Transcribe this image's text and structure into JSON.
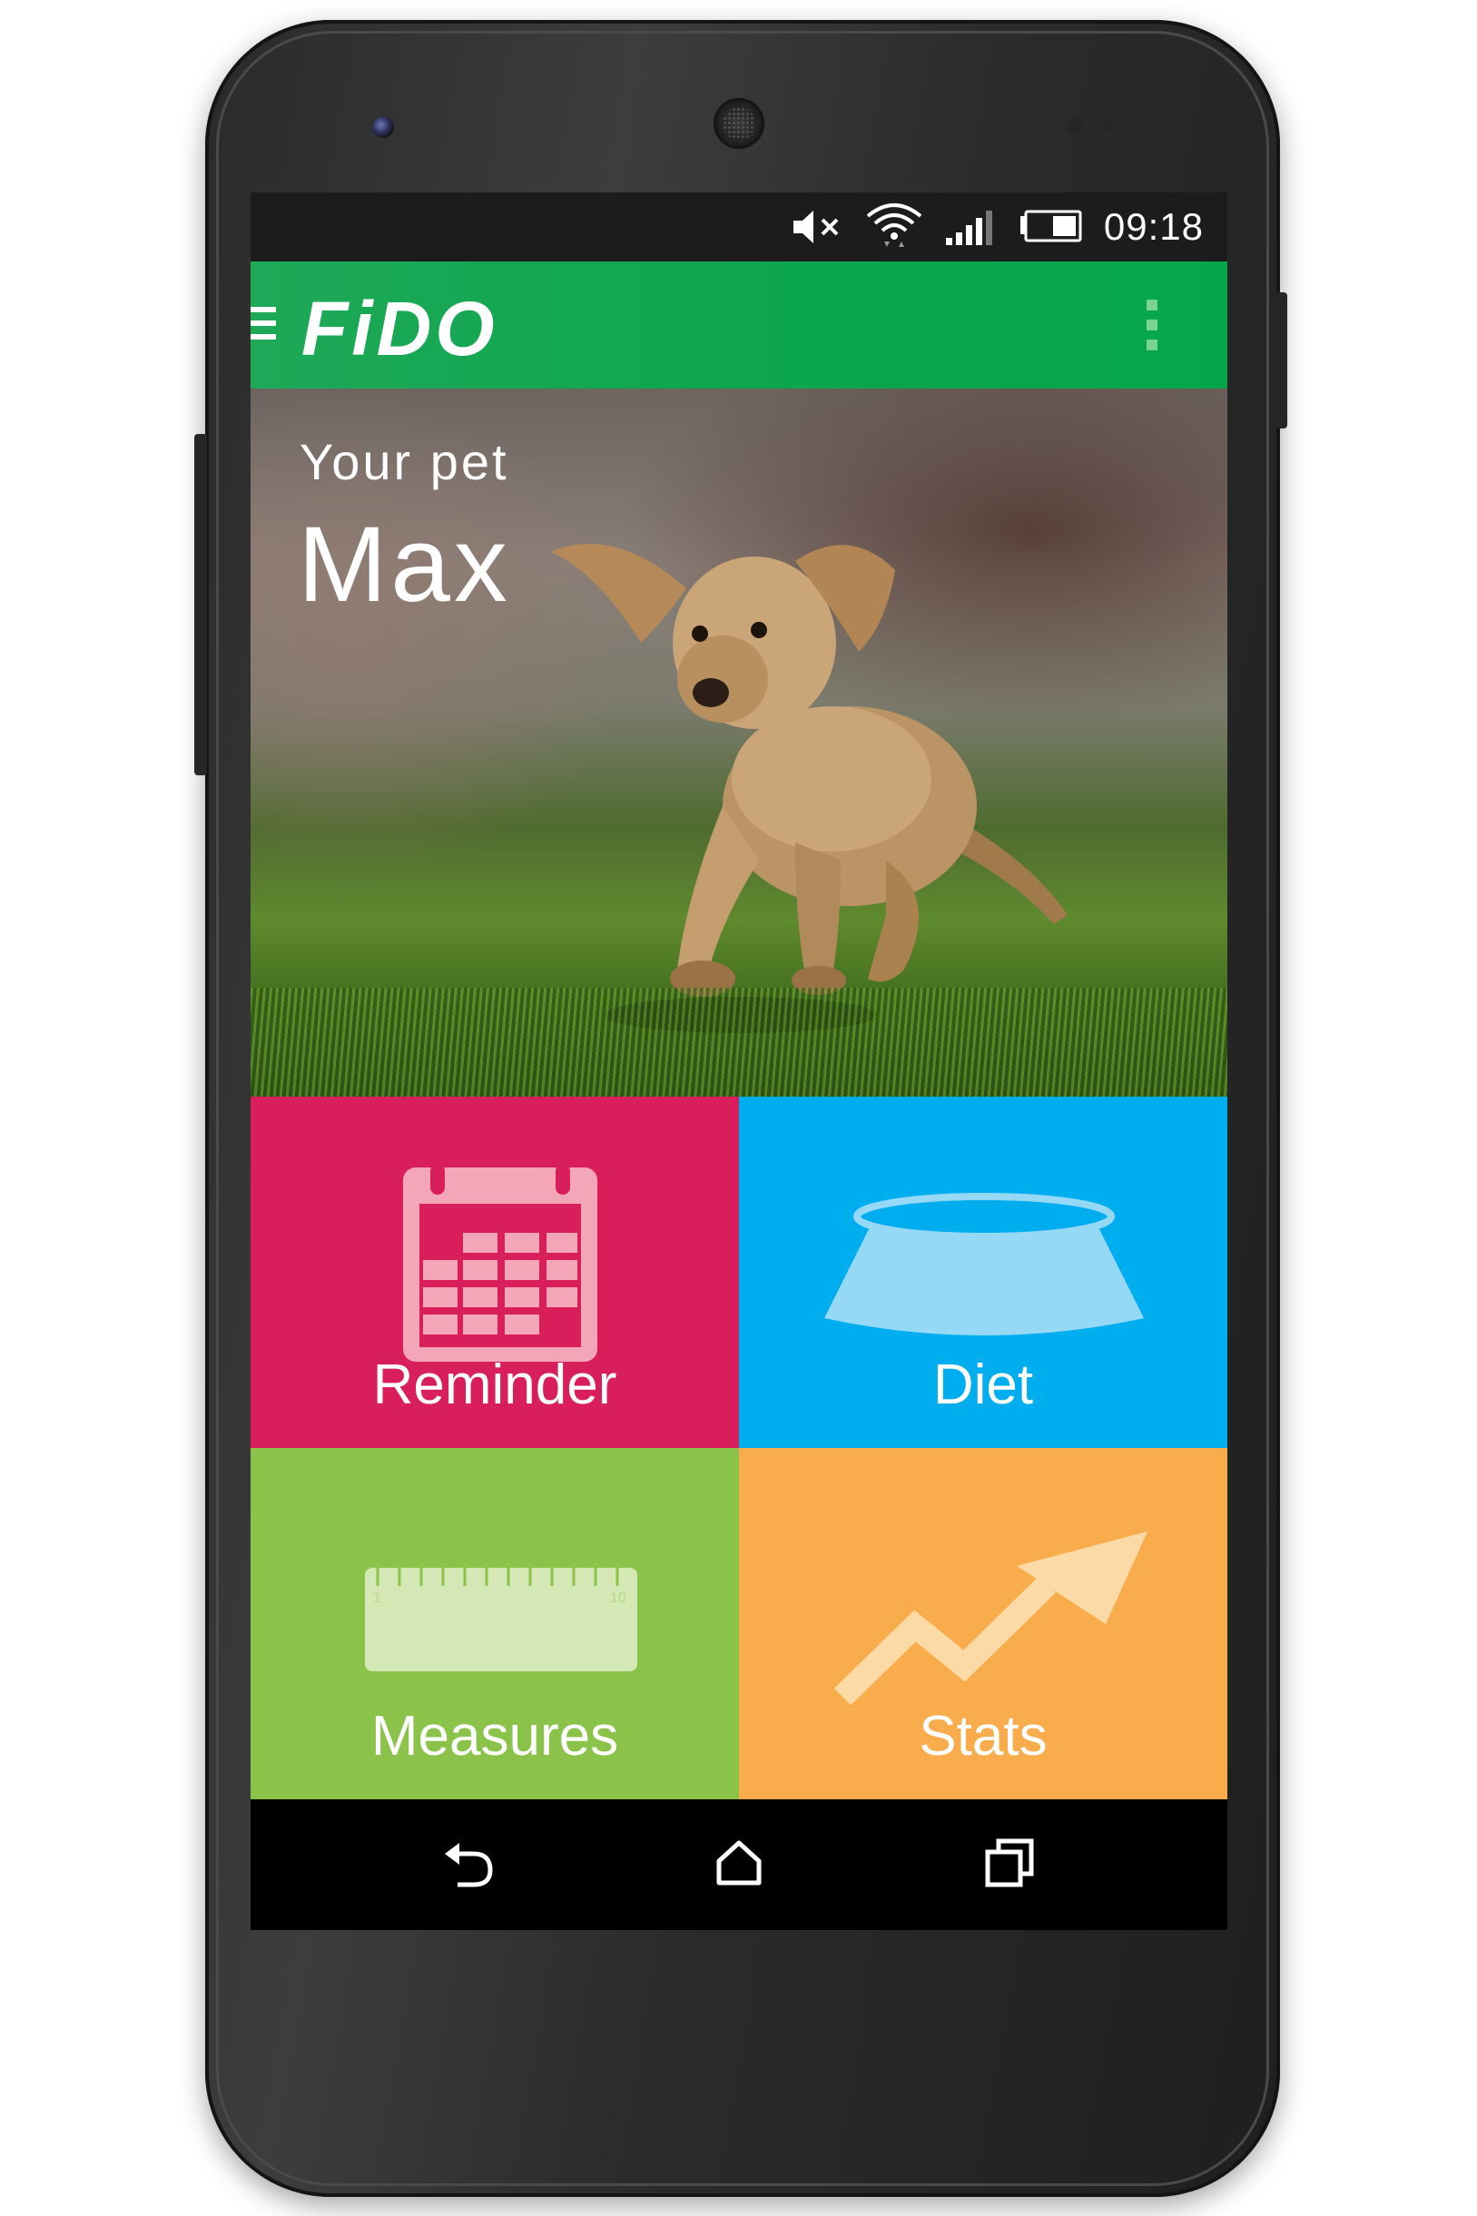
{
  "status_bar": {
    "time": "09:18",
    "icons": [
      "mute-icon",
      "wifi-icon",
      "signal-icon",
      "battery-icon"
    ]
  },
  "app_bar": {
    "logo": "FiDO",
    "menu_icon": "hamburger-icon",
    "overflow_icon": "overflow-menu-icon"
  },
  "hero": {
    "label": "Your pet",
    "pet_name": "Max"
  },
  "tiles": [
    {
      "label": "Reminder",
      "icon": "calendar-icon",
      "color": "#d81f5c"
    },
    {
      "label": "Diet",
      "icon": "bowl-icon",
      "color": "#00aeef"
    },
    {
      "label": "Measures",
      "icon": "ruler-icon",
      "color": "#8bc34a"
    },
    {
      "label": "Stats",
      "icon": "trend-arrow-icon",
      "color": "#f9ac4c"
    }
  ],
  "ruler_marks": {
    "start": "1",
    "end": "10"
  },
  "nav_bar": {
    "icons": [
      "back-icon",
      "home-icon",
      "recent-apps-icon"
    ]
  },
  "colors": {
    "brand_green": "#0ba64d",
    "status_bar": "#1c1c1c"
  }
}
